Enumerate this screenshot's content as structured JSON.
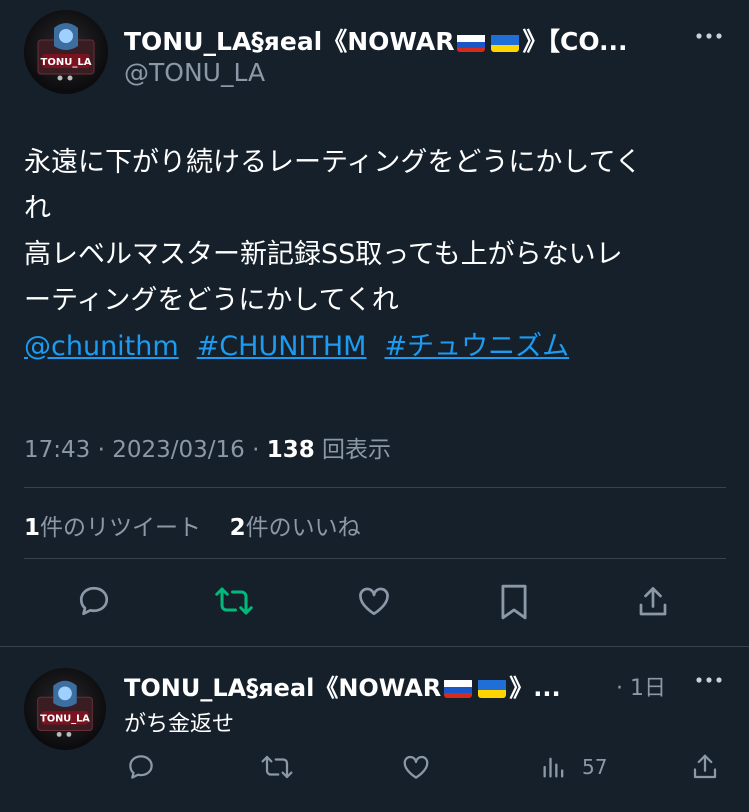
{
  "tweet": {
    "author_name": "TONU_LA§яeal《NOWAR",
    "author_name_tail": "》【CO...",
    "handle": "@TONU_LA",
    "text_lines": [
      "永遠に下がり続けるレーティングをどうにかしてく",
      "れ",
      "高レベルマスター新記録SS取っても上がらないレ",
      "ーティングをどうにかしてくれ"
    ],
    "links": [
      "@chunithm",
      "#CHUNITHM",
      "#チュウニズム"
    ],
    "time": "17:43 · 2023/03/16 · ",
    "views_count": "138",
    "views_label": " 回表示",
    "retweets_count": "1",
    "retweets_label": "件のリツイート",
    "likes_count": "2",
    "likes_label": "件のいいね",
    "avatar_text": "TONU_LA"
  },
  "reply": {
    "author_name": "TONU_LA§яeal《NOWAR",
    "author_name_tail": "》...",
    "time": "· 1日",
    "text": "がち金返せ",
    "views": "57",
    "avatar_text": "TONU_LA"
  },
  "icons": {
    "more": "more-horizontal-icon",
    "reply": "reply-icon",
    "retweet": "retweet-icon",
    "like": "heart-icon",
    "bookmark": "bookmark-icon",
    "share": "share-icon",
    "views": "analytics-icon"
  },
  "colors": {
    "background": "#15202b",
    "link": "#1d9bf0",
    "retweet_active": "#00ba7c",
    "secondary_text": "#8b98a5",
    "divider": "#38444d"
  }
}
